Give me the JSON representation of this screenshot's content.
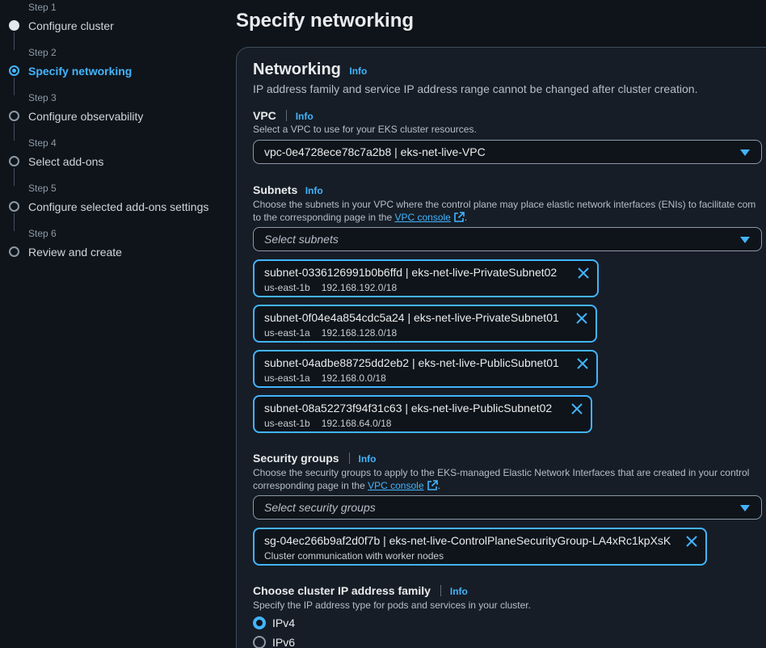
{
  "steps": [
    {
      "num": "Step 1",
      "label": "Configure cluster",
      "state": "done"
    },
    {
      "num": "Step 2",
      "label": "Specify networking",
      "state": "active"
    },
    {
      "num": "Step 3",
      "label": "Configure observability",
      "state": "todo"
    },
    {
      "num": "Step 4",
      "label": "Select add-ons",
      "state": "todo"
    },
    {
      "num": "Step 5",
      "label": "Configure selected add-ons settings",
      "state": "todo"
    },
    {
      "num": "Step 6",
      "label": "Review and create",
      "state": "todo"
    }
  ],
  "page_title": "Specify networking",
  "networking": {
    "title": "Networking",
    "info": "Info",
    "description": "IP address family and service IP address range cannot be changed after cluster creation."
  },
  "vpc": {
    "label": "VPC",
    "info": "Info",
    "description": "Select a VPC to use for your EKS cluster resources.",
    "value": "vpc-0e4728ece78c7a2b8 | eks-net-live-VPC"
  },
  "subnets": {
    "label": "Subnets",
    "info": "Info",
    "description_line1": "Choose the subnets in your VPC where the control plane may place elastic network interfaces (ENIs) to facilitate com",
    "description_line2_prefix": "to the corresponding page in the",
    "link": "VPC console",
    "description_line2_suffix": ".",
    "placeholder": "Select subnets",
    "selected": [
      {
        "name": "subnet-0336126991b0b6ffd | eks-net-live-PrivateSubnet02",
        "az": "us-east-1b",
        "cidr": "192.168.192.0/18"
      },
      {
        "name": "subnet-0f04e4a854cdc5a24 | eks-net-live-PrivateSubnet01",
        "az": "us-east-1a",
        "cidr": "192.168.128.0/18"
      },
      {
        "name": "subnet-04adbe88725dd2eb2 | eks-net-live-PublicSubnet01",
        "az": "us-east-1a",
        "cidr": "192.168.0.0/18"
      },
      {
        "name": "subnet-08a52273f94f31c63 | eks-net-live-PublicSubnet02",
        "az": "us-east-1b",
        "cidr": "192.168.64.0/18"
      }
    ]
  },
  "security_groups": {
    "label": "Security groups",
    "info": "Info",
    "description_line1": "Choose the security groups to apply to the EKS-managed Elastic Network Interfaces that are created in your control",
    "description_line2_prefix": "corresponding page in the",
    "link": "VPC console",
    "description_line2_suffix": ".",
    "placeholder": "Select security groups",
    "selected": [
      {
        "name": "sg-04ec266b9af2d0f7b | eks-net-live-ControlPlaneSecurityGroup-LA4xRc1kpXsK",
        "description": "Cluster communication with worker nodes"
      }
    ]
  },
  "ip_family": {
    "label": "Choose cluster IP address family",
    "info": "Info",
    "description": "Specify the IP address type for pods and services in your cluster.",
    "options": [
      {
        "label": "IPv4",
        "selected": true
      },
      {
        "label": "IPv6",
        "selected": false
      }
    ]
  },
  "colors": {
    "accent": "#42b4ff",
    "background": "#0f141a",
    "panel": "#161d26"
  }
}
